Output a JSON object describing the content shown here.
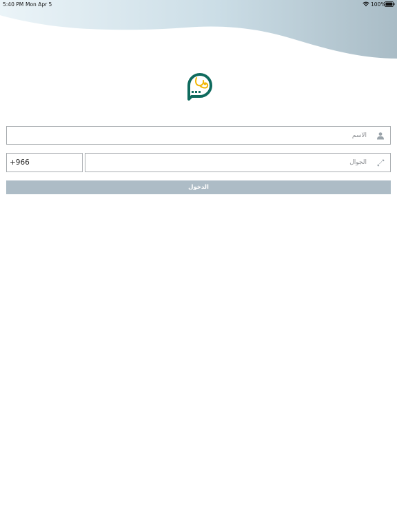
{
  "status_bar": {
    "time": "5:40 PM",
    "date": "Mon Apr 5",
    "battery": "100%",
    "wifi_icon": "wifi-icon",
    "battery_icon": "battery-full-icon"
  },
  "logo": {
    "icon": "speech-bubble-stethoscope-icon",
    "colors": {
      "bubble": "#0f6b5e",
      "stethoscope": "#f2b705"
    }
  },
  "form": {
    "name_field": {
      "placeholder": "الاسم",
      "value": "",
      "icon": "person-icon"
    },
    "phone_field": {
      "placeholder": "الجوال",
      "value": "",
      "icon": "phone-icon"
    },
    "country_code": {
      "value": "+966"
    },
    "login_button": {
      "label": "الدخول"
    }
  },
  "theme": {
    "wave_start": "#e6f1f6",
    "wave_end": "#a9bcc6",
    "button_bg": "#adbcc6",
    "field_border": "#a8acb0"
  }
}
